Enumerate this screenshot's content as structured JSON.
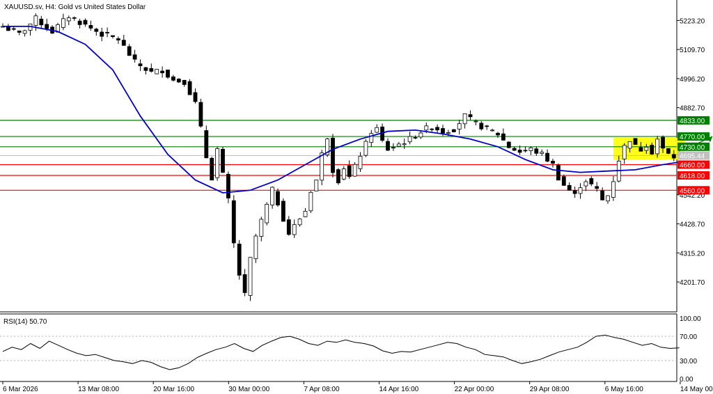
{
  "chart_data": [
    {
      "type": "candlestick",
      "title": "XAUUSD.sv, H4:  Gold vs United States Dollar",
      "ylim": [
        4085,
        5295
      ],
      "y_ticks": [
        "5223.20",
        "5109.70",
        "4996.20",
        "4882.70",
        "4542.20",
        "4428.70",
        "4315.20",
        "4201.70"
      ],
      "x_ticks": [
        "6 Mar 2026",
        "13 Mar 08:00",
        "20 Mar 16:00",
        "30 Mar 00:00",
        "7 Apr 08:00",
        "14 Apr 16:00",
        "22 Apr 00:00",
        "29 Apr 08:00",
        "6 May 16:00",
        "14 May 00:00"
      ],
      "current_price": "4695.44",
      "levels": [
        {
          "value": "4833.00",
          "color": "#008000"
        },
        {
          "value": "4770.00",
          "color": "#008000"
        },
        {
          "value": "4730.00",
          "color": "#008000"
        },
        {
          "value": "4660.00",
          "color": "#ff0000"
        },
        {
          "value": "4618.00",
          "color": "#ff0000"
        },
        {
          "value": "4560.00",
          "color": "#ff0000"
        }
      ],
      "price_path": [
        [
          0,
          5200
        ],
        [
          3,
          5170
        ],
        [
          6,
          5230
        ],
        [
          9,
          5180
        ],
        [
          12,
          5240
        ],
        [
          15,
          5205
        ],
        [
          18,
          5170
        ],
        [
          21,
          5150
        ],
        [
          24,
          5060
        ],
        [
          27,
          5020
        ],
        [
          29,
          5030
        ],
        [
          31,
          4990
        ],
        [
          33,
          4985
        ],
        [
          35,
          4900
        ],
        [
          36,
          4800
        ],
        [
          37,
          4690
        ],
        [
          38,
          4610
        ],
        [
          39,
          4720
        ],
        [
          40,
          4620
        ],
        [
          41,
          4520
        ],
        [
          42,
          4350
        ],
        [
          43,
          4230
        ],
        [
          44,
          4150
        ],
        [
          45,
          4290
        ],
        [
          46,
          4380
        ],
        [
          47,
          4440
        ],
        [
          48,
          4500
        ],
        [
          49,
          4560
        ],
        [
          50,
          4510
        ],
        [
          51,
          4450
        ],
        [
          52,
          4390
        ],
        [
          53,
          4420
        ],
        [
          54,
          4450
        ],
        [
          55,
          4480
        ],
        [
          56,
          4560
        ],
        [
          57,
          4600
        ],
        [
          58,
          4700
        ],
        [
          59,
          4770
        ],
        [
          60,
          4640
        ],
        [
          61,
          4600
        ],
        [
          62,
          4650
        ],
        [
          63,
          4610
        ],
        [
          64,
          4650
        ],
        [
          65,
          4700
        ],
        [
          66,
          4740
        ],
        [
          67,
          4790
        ],
        [
          68,
          4800
        ],
        [
          69,
          4750
        ],
        [
          70,
          4720
        ],
        [
          72,
          4740
        ],
        [
          74,
          4760
        ],
        [
          76,
          4790
        ],
        [
          78,
          4810
        ],
        [
          80,
          4790
        ],
        [
          82,
          4800
        ],
        [
          84,
          4850
        ],
        [
          86,
          4820
        ],
        [
          88,
          4800
        ],
        [
          90,
          4780
        ],
        [
          92,
          4730
        ],
        [
          94,
          4710
        ],
        [
          96,
          4720
        ],
        [
          98,
          4700
        ],
        [
          100,
          4660
        ],
        [
          101,
          4610
        ],
        [
          102,
          4580
        ],
        [
          103,
          4560
        ],
        [
          104,
          4540
        ],
        [
          105,
          4580
        ],
        [
          106,
          4600
        ],
        [
          107,
          4580
        ],
        [
          108,
          4560
        ],
        [
          109,
          4520
        ],
        [
          110,
          4540
        ],
        [
          111,
          4600
        ],
        [
          112,
          4680
        ],
        [
          113,
          4730
        ],
        [
          114,
          4760
        ],
        [
          115,
          4730
        ],
        [
          116,
          4720
        ],
        [
          117,
          4740
        ],
        [
          118,
          4710
        ],
        [
          119,
          4760
        ],
        [
          120,
          4720
        ],
        [
          121,
          4700
        ],
        [
          122,
          4690
        ],
        [
          123,
          4695
        ]
      ],
      "ma_path": [
        [
          0,
          5200
        ],
        [
          5,
          5200
        ],
        [
          10,
          5180
        ],
        [
          15,
          5130
        ],
        [
          20,
          5030
        ],
        [
          25,
          4850
        ],
        [
          30,
          4700
        ],
        [
          35,
          4600
        ],
        [
          40,
          4550
        ],
        [
          45,
          4560
        ],
        [
          50,
          4600
        ],
        [
          55,
          4660
        ],
        [
          60,
          4720
        ],
        [
          65,
          4760
        ],
        [
          70,
          4790
        ],
        [
          75,
          4795
        ],
        [
          80,
          4780
        ],
        [
          85,
          4760
        ],
        [
          90,
          4730
        ],
        [
          95,
          4680
        ],
        [
          100,
          4640
        ],
        [
          105,
          4630
        ],
        [
          110,
          4635
        ],
        [
          115,
          4640
        ],
        [
          120,
          4660
        ],
        [
          123,
          4670
        ]
      ],
      "series": [
        {
          "name": "XAUUSD.sv, H4",
          "color": "#000000"
        }
      ]
    },
    {
      "type": "line",
      "title": "RSI(14) 50.70",
      "ylim": [
        0,
        100
      ],
      "y_ticks": [
        "100.00",
        "70.00",
        "30.00",
        "0.00"
      ],
      "series": [
        {
          "name": "RSI(14) 50.70",
          "color": "#000000",
          "values": [
            45,
            52,
            48,
            58,
            50,
            62,
            55,
            48,
            42,
            38,
            40,
            35,
            30,
            28,
            25,
            30,
            27,
            20,
            15,
            18,
            25,
            35,
            42,
            48,
            52,
            58,
            50,
            45,
            55,
            62,
            68,
            70,
            65,
            58,
            55,
            62,
            60,
            64,
            60,
            58,
            54,
            46,
            42,
            45,
            44,
            48,
            52,
            56,
            60,
            58,
            52,
            48,
            40,
            38,
            36,
            30,
            25,
            28,
            32,
            38,
            44,
            48,
            52,
            60,
            70,
            72,
            68,
            65,
            60,
            55,
            58,
            52,
            50,
            51
          ]
        }
      ]
    }
  ]
}
